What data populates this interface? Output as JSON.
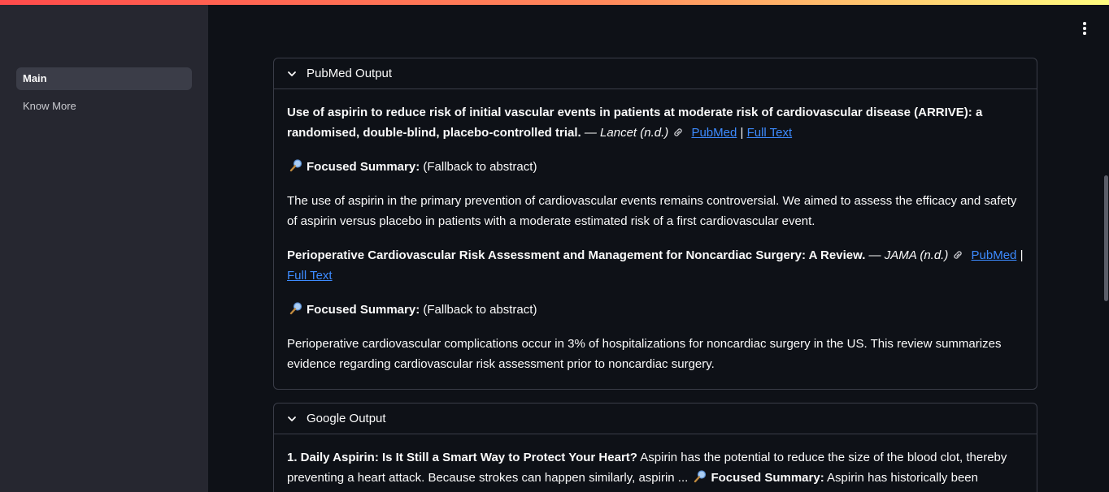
{
  "sidebar": {
    "items": [
      {
        "label": "Main",
        "active": true
      },
      {
        "label": "Know More",
        "active": false
      }
    ]
  },
  "icons": {
    "menu": "more-vertical-icon",
    "expand": "chevron-down-icon",
    "link": "link-icon",
    "summary": "magnifier-icon"
  },
  "colors": {
    "accent_link": "#3d8bff",
    "sidebar_bg": "#262730",
    "main_bg": "#0e1117"
  },
  "pubmed": {
    "title": "PubMed Output",
    "articles": [
      {
        "title": "Use of aspirin to reduce risk of initial vascular events in patients at moderate risk of cardiovascular disease (ARRIVE): a randomised, double-blind, placebo-controlled trial.",
        "journal": "— Lancet (n.d.)",
        "pubmed_label": "PubMed",
        "separator": "|",
        "fulltext_label": "Full Text",
        "summary_label": "Focused Summary:",
        "summary_note": "(Fallback to abstract)",
        "abstract": "The use of aspirin in the primary prevention of cardiovascular events remains controversial. We aimed to assess the efficacy and safety of aspirin versus placebo in patients with a moderate estimated risk of a first cardiovascular event."
      },
      {
        "title": "Perioperative Cardiovascular Risk Assessment and Management for Noncardiac Surgery: A Review.",
        "journal": "— JAMA (n.d.)",
        "pubmed_label": "PubMed",
        "separator": "|",
        "fulltext_label": "Full Text",
        "summary_label": "Focused Summary:",
        "summary_note": "(Fallback to abstract)",
        "abstract": "Perioperative cardiovascular complications occur in 3% of hospitalizations for noncardiac surgery in the US. This review summarizes evidence regarding cardiovascular risk assessment prior to noncardiac surgery."
      }
    ]
  },
  "google": {
    "title": "Google Output",
    "results": [
      {
        "title": "1. Daily Aspirin: Is It Still a Smart Way to Protect Your Heart?",
        "snippet": "Aspirin has the potential to reduce the size of the blood clot, thereby preventing a heart attack. Because strokes can happen similarly, aspirin ...",
        "summary_label": "Focused Summary:",
        "summary_text": "Aspirin has historically been"
      }
    ]
  }
}
